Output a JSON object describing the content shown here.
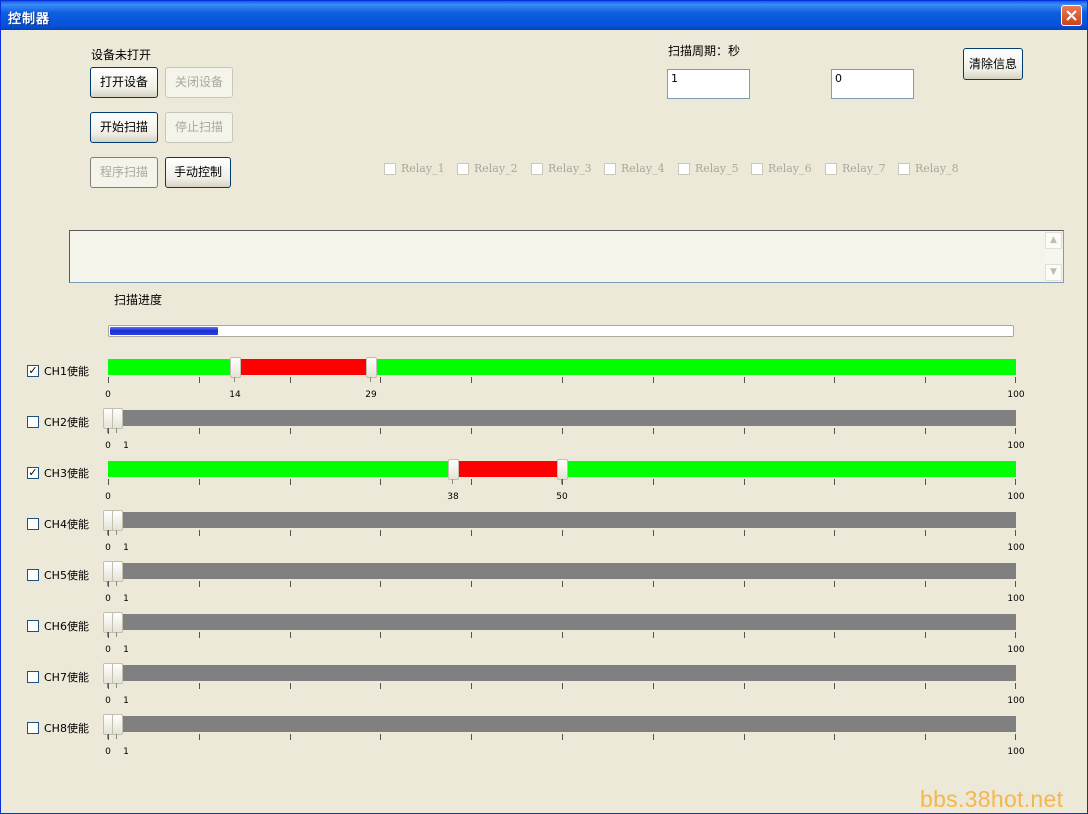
{
  "window": {
    "title": "控制器"
  },
  "device": {
    "status": "设备未打开",
    "open_label": "打开设备",
    "close_label": "关闭设备",
    "start_scan_label": "开始扫描",
    "stop_scan_label": "停止扫描",
    "program_scan_label": "程序扫描",
    "manual_control_label": "手动控制"
  },
  "scan": {
    "period_label": "扫描周期：秒",
    "period_value": "1",
    "second_value": "0"
  },
  "clear_label": "清除信息",
  "relays": [
    "Relay_1",
    "Relay_2",
    "Relay_3",
    "Relay_4",
    "Relay_5",
    "Relay_6",
    "Relay_7",
    "Relay_8"
  ],
  "progress": {
    "label": "扫描进度",
    "fraction": 0.12
  },
  "channels": [
    {
      "label": "CH1使能",
      "checked": true,
      "low": 14,
      "high": 29,
      "low_label": "14",
      "high_label": "29",
      "min_label": "0",
      "max_label": "100"
    },
    {
      "label": "CH2使能",
      "checked": false,
      "low": 0,
      "high": 1,
      "low_label": "0",
      "high_label": "1",
      "min_label": "0",
      "max_label": "100"
    },
    {
      "label": "CH3使能",
      "checked": true,
      "low": 38,
      "high": 50,
      "low_label": "38",
      "high_label": "50",
      "min_label": "0",
      "max_label": "100"
    },
    {
      "label": "CH4使能",
      "checked": false,
      "low": 0,
      "high": 1,
      "low_label": "0",
      "high_label": "1",
      "min_label": "0",
      "max_label": "100"
    },
    {
      "label": "CH5使能",
      "checked": false,
      "low": 0,
      "high": 1,
      "low_label": "0",
      "high_label": "1",
      "min_label": "0",
      "max_label": "100"
    },
    {
      "label": "CH6使能",
      "checked": false,
      "low": 0,
      "high": 1,
      "low_label": "0",
      "high_label": "1",
      "min_label": "0",
      "max_label": "100"
    },
    {
      "label": "CH7使能",
      "checked": false,
      "low": 0,
      "high": 1,
      "low_label": "0",
      "high_label": "1",
      "min_label": "0",
      "max_label": "100"
    },
    {
      "label": "CH8使能",
      "checked": false,
      "low": 0,
      "high": 1,
      "low_label": "0",
      "high_label": "1",
      "min_label": "0",
      "max_label": "100"
    }
  ],
  "colors": {
    "in_range": "#00ff00",
    "selected_range": "#ff0000",
    "disabled": "#808080"
  },
  "watermark": "bbs.38hot.net"
}
